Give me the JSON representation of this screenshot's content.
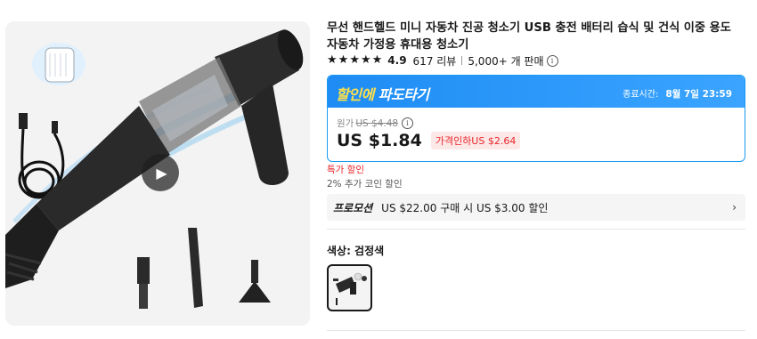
{
  "product": {
    "title": "무선 핸드헬드 미니 자동차 진공 청소기 USB 충전 배터리 습식 및 건식 이중 용도 자동차 가정용 휴대용 청소기",
    "rating": "4.9",
    "reviews": "617 리뷰",
    "sold": "5,000+ 개 판매"
  },
  "deal": {
    "name_highlight": "할인에",
    "name_rest": " 파도타기",
    "end_label": "종료시간:",
    "end_time": "8월 7일 23:59",
    "original_label": "원가",
    "original_price": "US $4.48",
    "price": "US $1.84",
    "drop_badge": "가격인하US $2.64"
  },
  "sale_label": "특가 할인",
  "coin_label": "2% 추가 코인 할인",
  "promotion": {
    "tag": "프로모션",
    "text": "US $22.00 구매 시 US $3.00 할인"
  },
  "color": {
    "label": "색상: 검정색"
  },
  "icons": {
    "star": "★",
    "info": "i",
    "chevron": "›",
    "play": "▶"
  },
  "colors": {
    "accent_blue": "#1a9af5",
    "deal_yellow": "#ffe14a",
    "price_red": "#e8262a"
  }
}
